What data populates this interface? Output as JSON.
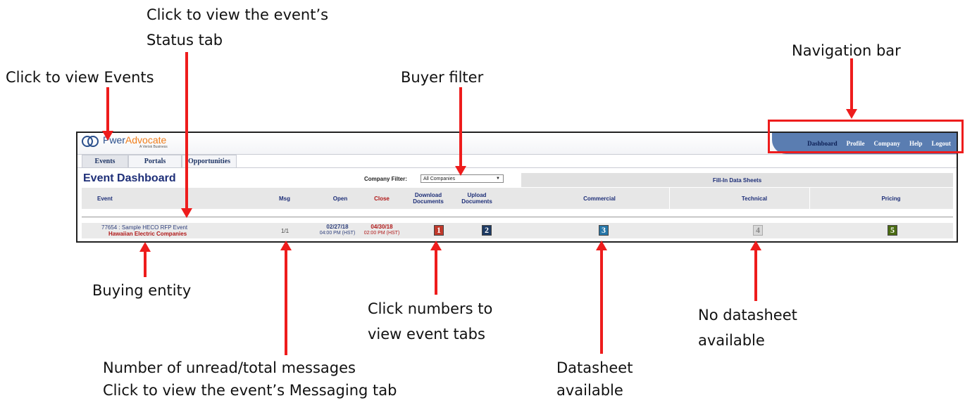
{
  "annotations": {
    "status_tab_line1": "Click to view the event’s",
    "status_tab_line2": "Status tab",
    "events": "Click to view Events",
    "buyer_filter": "Buyer filter",
    "navigation_bar": "Navigation bar",
    "buying_entity": "Buying entity",
    "numbers_line1": "Click numbers to",
    "numbers_line2": "view event tabs",
    "no_datasheet_line1": "No datasheet",
    "no_datasheet_line2": "available",
    "messages_line1": "Number of unread/total messages",
    "messages_line2": "Click to view the event’s Messaging tab",
    "datasheet_line1": "Datasheet",
    "datasheet_line2": "available"
  },
  "logo": {
    "name_part1": "P",
    "name_part2": "wer",
    "name_part3": "Advocate",
    "tagline": "A Verisk Business"
  },
  "nav": {
    "items": [
      "Dashboard",
      "Profile",
      "Company",
      "Help",
      "Logout"
    ]
  },
  "tabs": [
    "Events",
    "Portals",
    "Opportunities"
  ],
  "dashboard": {
    "title": "Event Dashboard",
    "filter_label": "Company Filter:",
    "filter_value": "All Companies",
    "fill_in_header": "Fill-In Data Sheets"
  },
  "columns": {
    "event": "Event",
    "msg": "Msg",
    "open": "Open",
    "close": "Close",
    "download": "Download Documents",
    "upload": "Upload Documents",
    "commercial": "Commercial",
    "technical": "Technical",
    "pricing": "Pricing"
  },
  "row": {
    "event_name": "77654 : Sample HECO RFP Event",
    "buyer": "Hawaiian Electric Companies",
    "msg": "1/1",
    "open_date": "02/27/18",
    "open_time": "04:00 PM (HST)",
    "close_date": "04/30/18",
    "close_time": "02:00 PM (HST)",
    "tab_numbers": [
      "1",
      "2",
      "3",
      "4",
      "5"
    ]
  },
  "colors": {
    "arrow": "#ee1c1c",
    "nav_bar": "#5a7db1",
    "title": "#1e2f78",
    "close_red": "#b01818",
    "btn_download": "#c0392b",
    "btn_upload": "#1d3a63",
    "btn_commercial": "#2676a8",
    "btn_technical_disabled": "#d8d8d8",
    "btn_pricing": "#4a6b12"
  }
}
